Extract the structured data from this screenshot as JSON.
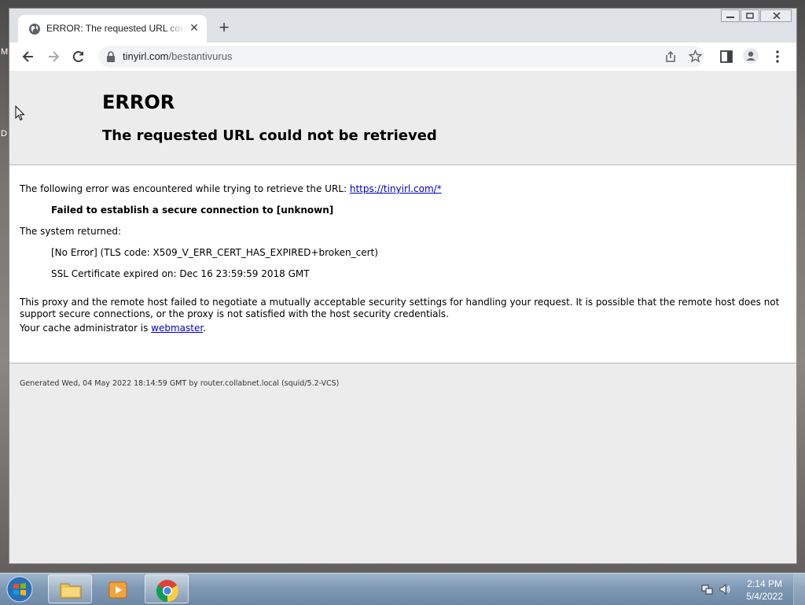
{
  "desktop": {
    "letter_m": "M",
    "letter_d": "D"
  },
  "browser": {
    "tab": {
      "title": "ERROR: The requested URL could not be retrieved",
      "close": "✕"
    },
    "new_tab": "+",
    "address": {
      "host": "tinyirl.com",
      "path": "/bestantivurus"
    }
  },
  "page": {
    "title": "ERROR",
    "subtitle": "The requested URL could not be retrieved",
    "intro": "The following error was encountered while trying to retrieve the URL: ",
    "intro_link": "https://tinyirl.com/*",
    "failed": "Failed to establish a secure connection to [unknown]",
    "system_returned": "The system returned:",
    "no_error": "[No Error] (TLS code: X509_V_ERR_CERT_HAS_EXPIRED+broken_cert)",
    "ssl_expired": "SSL Certificate expired on: Dec 16 23:59:59 2018 GMT",
    "paragraph": "This proxy and the remote host failed to negotiate a mutually acceptable security settings for handling your request. It is possible that the remote host does not support secure connections, or the proxy is not satisfied with the host security credentials.",
    "admin_prefix": "Your cache administrator is ",
    "admin_link": "webmaster",
    "admin_suffix": ".",
    "footer": "Generated Wed, 04 May 2022 18:14:59 GMT by router.collabnet.local (squid/5.2-VCS)"
  },
  "taskbar": {
    "time": "2:14 PM",
    "date": "5/4/2022"
  }
}
